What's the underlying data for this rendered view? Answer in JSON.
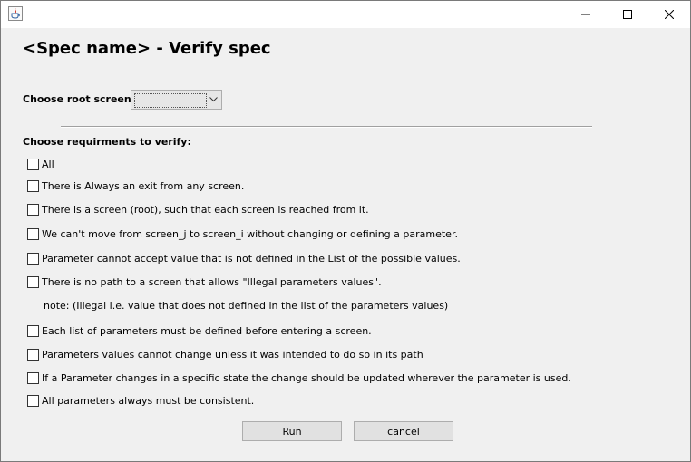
{
  "window": {
    "app_icon": "java-cup-icon",
    "controls": [
      "minimize-icon",
      "maximize-icon",
      "close-icon"
    ]
  },
  "heading": "<Spec name> - Verify spec",
  "root_screen": {
    "label": "Choose root screen:",
    "selected": ""
  },
  "requirements": {
    "label": "Choose requirments to verify:",
    "items": [
      "All",
      "There is Always an exit from any screen.",
      "There is a screen (root), such that each screen is reached from it.",
      "We can't  move from screen_j to screen_i without changing or defining a parameter.",
      "Parameter cannot accept value that is not defined in the List of the possible values.",
      "There is no path to a screen that allows  \"Illegal parameters values\".",
      "Each list of parameters must be defined before entering a screen.",
      "Parameters values cannot change unless it was intended to do so in its path",
      "If a Parameter changes  in a specific state the change should be updated wherever the parameter is used.",
      "All parameters always must be consistent."
    ],
    "note": "note: (Illegal i.e. value that does not defined in the list of the parameters values)"
  },
  "buttons": {
    "run": "Run",
    "cancel": "cancel"
  }
}
